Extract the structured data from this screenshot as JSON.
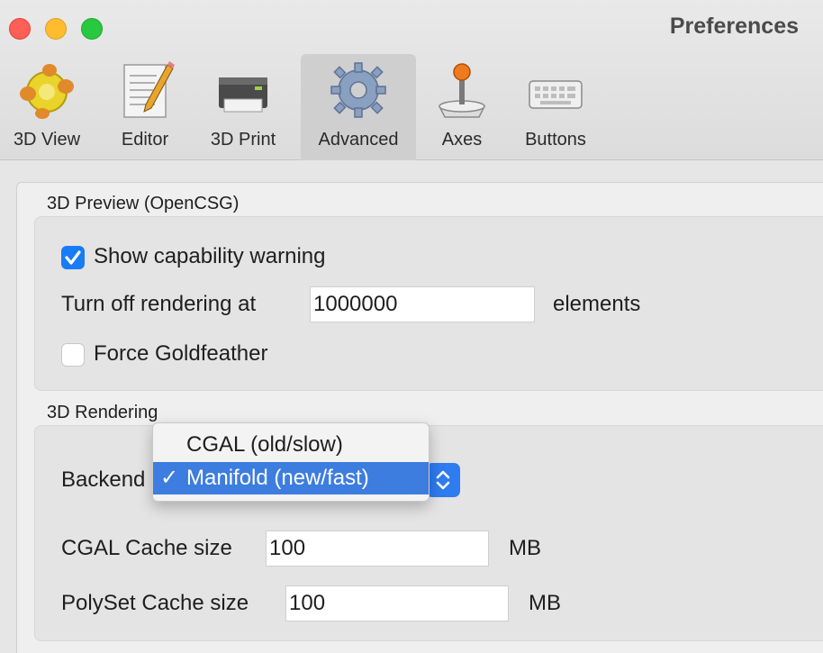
{
  "window": {
    "title": "Preferences"
  },
  "colors": {
    "accent": "#1a7cf5",
    "selection": "#3d7de0"
  },
  "tabs": [
    {
      "label": "3D View",
      "icon": "3d-view-icon"
    },
    {
      "label": "Editor",
      "icon": "editor-icon"
    },
    {
      "label": "3D Print",
      "icon": "printer-icon"
    },
    {
      "label": "Advanced",
      "icon": "gear-icon",
      "active": true
    },
    {
      "label": "Axes",
      "icon": "joystick-icon"
    },
    {
      "label": "Buttons",
      "icon": "keyboard-icon"
    }
  ],
  "preview": {
    "title": "3D Preview (OpenCSG)",
    "show_warning_label": "Show capability warning",
    "show_warning_checked": true,
    "turn_off_label": "Turn off rendering at",
    "turn_off_value": "1000000",
    "turn_off_unit": "elements",
    "goldfeather_label": "Force Goldfeather",
    "goldfeather_checked": false
  },
  "rendering": {
    "title": "3D Rendering",
    "backend_label": "Backend",
    "backend_options": [
      "CGAL (old/slow)",
      "Manifold (new/fast)"
    ],
    "backend_selected": "Manifold (new/fast)",
    "check_mark": "✓",
    "cgal_cache_label": "CGAL Cache size",
    "cgal_cache_value": "100",
    "cgal_cache_unit": "MB",
    "polyset_cache_label": "PolySet Cache size",
    "polyset_cache_value": "100",
    "polyset_cache_unit": "MB"
  }
}
